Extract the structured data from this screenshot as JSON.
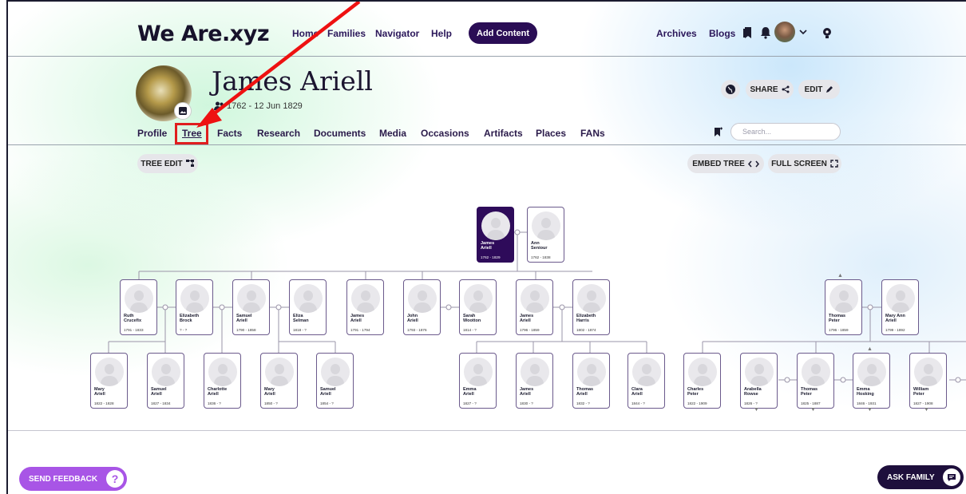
{
  "header": {
    "logo": "We Are.xyz",
    "nav_links": [
      "Home",
      "Families",
      "Navigator",
      "Help"
    ],
    "add_content": "Add Content",
    "right_links": [
      "Archives",
      "Blogs"
    ]
  },
  "profile": {
    "name": "James Ariell",
    "dates": "1762 - 12 Jun 1829",
    "share_label": "SHARE",
    "edit_label": "EDIT"
  },
  "tabs": [
    "Profile",
    "Tree",
    "Facts",
    "Research",
    "Documents",
    "Media",
    "Occasions",
    "Artifacts",
    "Places",
    "FANs"
  ],
  "active_tab": "Tree",
  "search": {
    "placeholder": "Search..."
  },
  "tree_toolbar": {
    "tree_edit": "TREE EDIT",
    "embed_tree": "EMBED TREE",
    "full_screen": "FULL SCREEN"
  },
  "tree": {
    "gen0": [
      {
        "first": "James",
        "last": "Ariell",
        "dates": "1762 - 1829"
      },
      {
        "first": "Ann",
        "last": "Seniour",
        "dates": "1762 - 1838"
      }
    ],
    "gen1": [
      {
        "first": "Ruth",
        "last": "Crucefix",
        "dates": "1791 - 1833"
      },
      {
        "first": "Elizabeth",
        "last": "Brock",
        "dates": "? - ?"
      },
      {
        "first": "Samuel",
        "last": "Ariell",
        "dates": "1790 - 1858"
      },
      {
        "first": "Eliza",
        "last": "Selman",
        "dates": "1818 - ?"
      },
      {
        "first": "James",
        "last": "Ariell",
        "dates": "1791 - 1794"
      },
      {
        "first": "John",
        "last": "Ariell",
        "dates": "1793 - 1876"
      },
      {
        "first": "Sarah",
        "last": "Wootton",
        "dates": "1814 - ?"
      },
      {
        "first": "James",
        "last": "Ariell",
        "dates": "1796 - 1859"
      },
      {
        "first": "Elizabeth",
        "last": "Harris",
        "dates": "1802 - 1874"
      },
      {
        "first": "Thomas",
        "last": "Peter",
        "dates": "1796 - 1859"
      },
      {
        "first": "Mary Ann",
        "last": "Ariell",
        "dates": "1799 - 1892"
      }
    ],
    "gen2": [
      {
        "first": "Mary",
        "last": "Ariell",
        "dates": "1822 - 1828"
      },
      {
        "first": "Samuel",
        "last": "Ariell",
        "dates": "1827 - 1834"
      },
      {
        "first": "Charlotte",
        "last": "Ariell",
        "dates": "1836 - ?"
      },
      {
        "first": "Mary",
        "last": "Ariell",
        "dates": "1850 - ?"
      },
      {
        "first": "Samuel",
        "last": "Ariell",
        "dates": "1854 - ?"
      },
      {
        "first": "Emma",
        "last": "Ariell",
        "dates": "1827 - ?"
      },
      {
        "first": "James",
        "last": "Ariell",
        "dates": "1830 - ?"
      },
      {
        "first": "Thomas",
        "last": "Ariell",
        "dates": "1832 - ?"
      },
      {
        "first": "Clara",
        "last": "Ariell",
        "dates": "1844 - ?"
      },
      {
        "first": "Charles",
        "last": "Peter",
        "dates": "1822 - 1909"
      },
      {
        "first": "Arabella",
        "last": "Rowse",
        "dates": "1826 - ?"
      },
      {
        "first": "Thomas",
        "last": "Peter",
        "dates": "1825 - 1887"
      },
      {
        "first": "Emma",
        "last": "Hosking",
        "dates": "1846 - 1931"
      },
      {
        "first": "William",
        "last": "Peter",
        "dates": "1827 - 1908"
      }
    ]
  },
  "footer": {
    "send_feedback": "SEND FEEDBACK",
    "ask_family": "ASK FAMILY"
  }
}
